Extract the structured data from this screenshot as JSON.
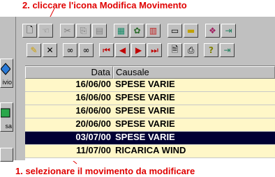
{
  "annotations": {
    "top": "2. cliccare l'icona Modifica Movimento",
    "bottom": "1. selezionare il movimento da modificare"
  },
  "side": {
    "btn1_label": "ivio",
    "btn2_label": "sa"
  },
  "table": {
    "headers": [
      "Data",
      "Causale"
    ],
    "rows": [
      [
        "16/06/00",
        "SPESE VARIE"
      ],
      [
        "16/06/00",
        "SPESE VARIE"
      ],
      [
        "16/06/00",
        "SPESE VARIE"
      ],
      [
        "20/06/00",
        "SPESE VARIE"
      ],
      [
        "03/07/00",
        "SPESE VARIE"
      ],
      [
        "11/07/00",
        "RICARICA WIND"
      ]
    ],
    "selected_row": 4
  },
  "colors": {
    "annotation": "#e00000",
    "row_bg": "#fff7c8",
    "selected_bg": "#000033"
  },
  "icons": {
    "toolbar1": [
      "new-document-icon",
      "handshake-icon",
      "cut-icon",
      "copy-icon",
      "paste-icon",
      "calculator-icon",
      "tools-icon",
      "chart-icon",
      "dialog-icon",
      "field-icon",
      "book-icon",
      "exit-icon"
    ],
    "toolbar2": [
      "pencil-edit-icon",
      "delete-x-icon",
      "binoculars-icon",
      "binoculars-next-icon",
      "first-record-icon",
      "prev-record-icon",
      "next-record-icon",
      "last-record-icon",
      "print-preview-icon",
      "printer-icon",
      "help-icon",
      "exit-door-icon"
    ]
  }
}
